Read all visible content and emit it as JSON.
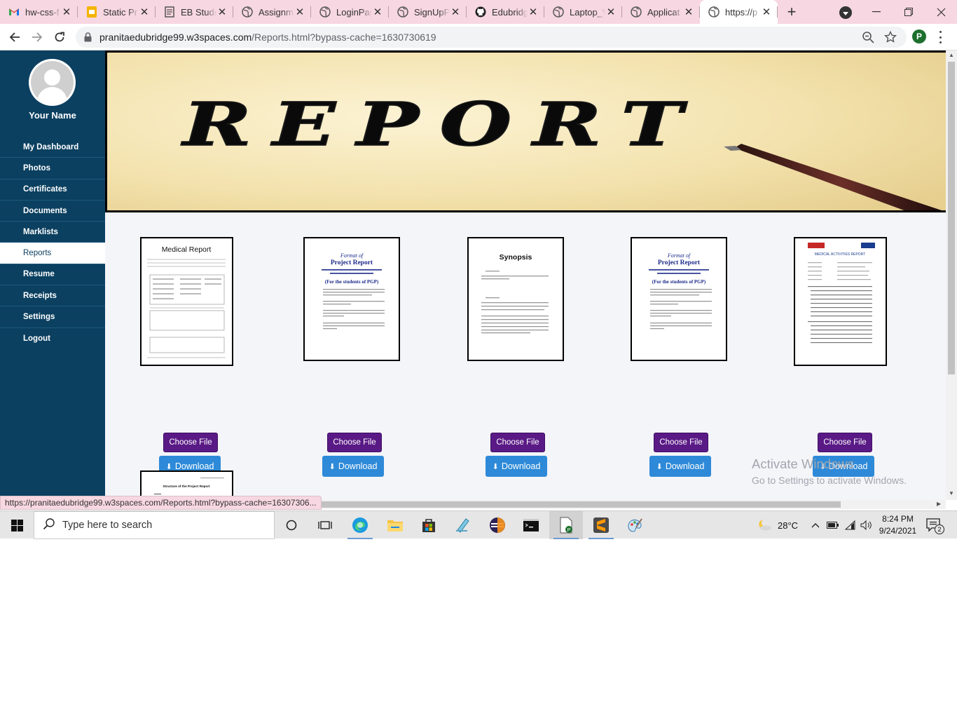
{
  "browser": {
    "tabs": [
      {
        "label": "hw-css-f",
        "icon": "gmail-icon"
      },
      {
        "label": "Static Pr",
        "icon": "slides-icon"
      },
      {
        "label": "EB Stude",
        "icon": "eb-icon"
      },
      {
        "label": "Assignm",
        "icon": "globe-icon"
      },
      {
        "label": "LoginPag",
        "icon": "globe-icon"
      },
      {
        "label": "SignUpP",
        "icon": "globe-icon"
      },
      {
        "label": "Edubridg",
        "icon": "github-icon"
      },
      {
        "label": "Laptop_V",
        "icon": "globe-icon"
      },
      {
        "label": "Applicat",
        "icon": "globe-icon"
      },
      {
        "label": "https://p",
        "icon": "globe-icon",
        "active": true
      }
    ],
    "url_host": "pranitaedubridge99.w3spaces.com",
    "url_path": "/Reports.html?bypass-cache=1630730619",
    "profile_initial": "P",
    "status_url": "https://pranitaedubridge99.w3spaces.com/Reports.html?bypass-cache=16307306..."
  },
  "sidebar": {
    "user_name": "Your Name",
    "items": [
      {
        "label": "My Dashboard"
      },
      {
        "label": "Photos"
      },
      {
        "label": "Certificates"
      },
      {
        "label": "Documents"
      },
      {
        "label": "Marklists"
      },
      {
        "label": "Reports",
        "active": true
      },
      {
        "label": "Resume"
      },
      {
        "label": "Receipts"
      },
      {
        "label": "Settings"
      },
      {
        "label": "Logout"
      }
    ]
  },
  "banner": {
    "text": "REPORT"
  },
  "reports": [
    {
      "thumb_title": "Medical Report",
      "choose_label": "Choose File",
      "download_label": "Download"
    },
    {
      "thumb_title": "Format of",
      "thumb_subtitle": "Project Report",
      "thumb_note": "(For the students of PGP)",
      "choose_label": "Choose File",
      "download_label": "Download"
    },
    {
      "thumb_title": "Synopsis",
      "choose_label": "Choose File",
      "download_label": "Download"
    },
    {
      "thumb_title": "Format of",
      "thumb_subtitle": "Project Report",
      "thumb_note": "(For the students of PGP)",
      "choose_label": "Choose File",
      "download_label": "Download"
    },
    {
      "thumb_title": "MEDICAL ACTIVITIES REPORT",
      "choose_label": "Choose File",
      "download_label": "Download"
    },
    {
      "thumb_title": "Structure of the Project Report"
    }
  ],
  "watermark": {
    "line1": "Activate Windows",
    "line2": "Go to Settings to activate Windows."
  },
  "taskbar": {
    "search_placeholder": "Type here to search",
    "temperature": "28°C",
    "time": "8:24 PM",
    "date": "9/24/2021",
    "notification_count": "2"
  },
  "colors": {
    "sidebar": "#0b4060",
    "choose_button": "#5a1a86",
    "download_button": "#2e8ad8",
    "tabstrip": "#f7d7e1",
    "content_bg": "#f4f5f9"
  }
}
